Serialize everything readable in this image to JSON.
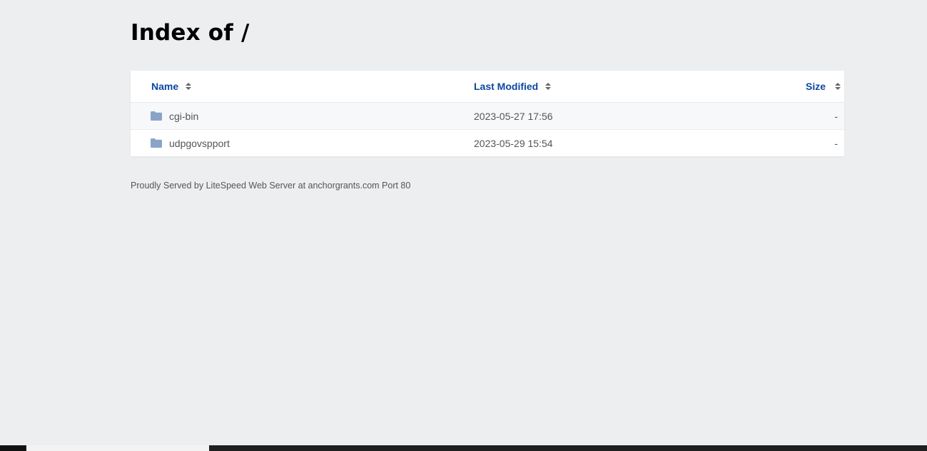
{
  "page": {
    "title": "Index of /"
  },
  "table": {
    "headers": {
      "name": "Name",
      "last_modified": "Last Modified",
      "size": "Size"
    },
    "rows": [
      {
        "name": "cgi-bin",
        "modified": "2023-05-27 17:56",
        "size": "-",
        "icon": "folder-icon"
      },
      {
        "name": "udpgovspport",
        "modified": "2023-05-29 15:54",
        "size": "-",
        "icon": "folder-icon"
      }
    ]
  },
  "footer": {
    "text": "Proudly Served by LiteSpeed Web Server at anchorgrants.com Port 80"
  },
  "colors": {
    "background": "#edeef0",
    "header_link": "#0d47a1",
    "folder": "#8aa4c8"
  }
}
